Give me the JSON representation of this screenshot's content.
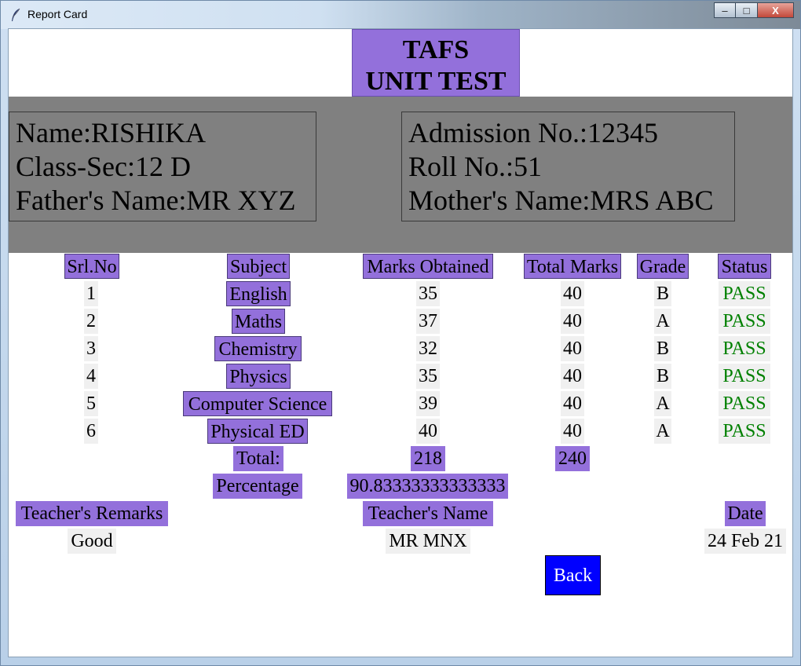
{
  "window": {
    "title": "Report Card",
    "minimize_label": "–",
    "maximize_label": "□",
    "close_label": "X"
  },
  "header": {
    "line1": "TAFS",
    "line2": "UNIT TEST"
  },
  "student": {
    "name": "Name:RISHIKA",
    "class_sec": "Class-Sec:12 D",
    "father": "Father's Name:MR XYZ",
    "admission": "Admission No.:12345",
    "roll": "Roll No.:51",
    "mother": "Mother's Name:MRS ABC"
  },
  "columns": {
    "srl": "Srl.No",
    "subject": "Subject",
    "obtained": "Marks Obtained",
    "total": "Total Marks",
    "grade": "Grade",
    "status": "Status"
  },
  "rows": [
    {
      "srl": "1",
      "subject": "English",
      "obtained": "35",
      "total": "40",
      "grade": "B",
      "status": "PASS"
    },
    {
      "srl": "2",
      "subject": "Maths",
      "obtained": "37",
      "total": "40",
      "grade": "A",
      "status": "PASS"
    },
    {
      "srl": "3",
      "subject": "Chemistry",
      "obtained": "32",
      "total": "40",
      "grade": "B",
      "status": "PASS"
    },
    {
      "srl": "4",
      "subject": "Physics",
      "obtained": "35",
      "total": "40",
      "grade": "B",
      "status": "PASS"
    },
    {
      "srl": "5",
      "subject": "Computer Science",
      "obtained": "39",
      "total": "40",
      "grade": "A",
      "status": "PASS"
    },
    {
      "srl": "6",
      "subject": "Physical ED",
      "obtained": "40",
      "total": "40",
      "grade": "A",
      "status": "PASS"
    }
  ],
  "summary": {
    "total_label": "Total:",
    "total_obtained": "218",
    "total_max": "240",
    "percentage_label": "Percentage",
    "percentage_value": "90.83333333333333"
  },
  "footer": {
    "remarks_label": "Teacher's Remarks",
    "remarks_value": "Good",
    "teacher_label": "Teacher's Name",
    "teacher_value": "MR MNX",
    "date_label": "Date",
    "date_value": "24 Feb 21"
  },
  "back_label": "Back",
  "colors": {
    "header_purple": "#9370db",
    "band_gray": "#808080",
    "pass_green": "#008000",
    "back_blue": "#0000ff"
  }
}
